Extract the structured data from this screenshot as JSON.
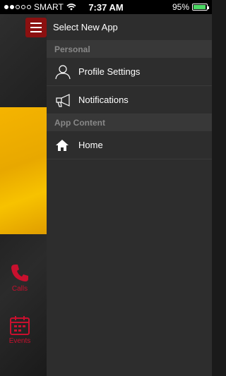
{
  "status_bar": {
    "carrier": "SMART",
    "time": "7:37 AM",
    "battery_percent": "95%",
    "battery_level": 0.95
  },
  "background_app": {
    "calls_label": "Calls",
    "events_label": "Events"
  },
  "drawer": {
    "header_title": "Select New App",
    "sections": [
      {
        "title": "Personal",
        "items": [
          {
            "label": "Profile Settings",
            "icon": "person-icon"
          },
          {
            "label": "Notifications",
            "icon": "megaphone-icon"
          }
        ]
      },
      {
        "title": "App Content",
        "items": [
          {
            "label": "Home",
            "icon": "home-icon"
          }
        ]
      }
    ]
  },
  "colors": {
    "accent_red": "#8b1010",
    "drawer_bg": "#2d2d2d",
    "section_bg": "#383838",
    "yellow_banner": "#f5b400"
  }
}
